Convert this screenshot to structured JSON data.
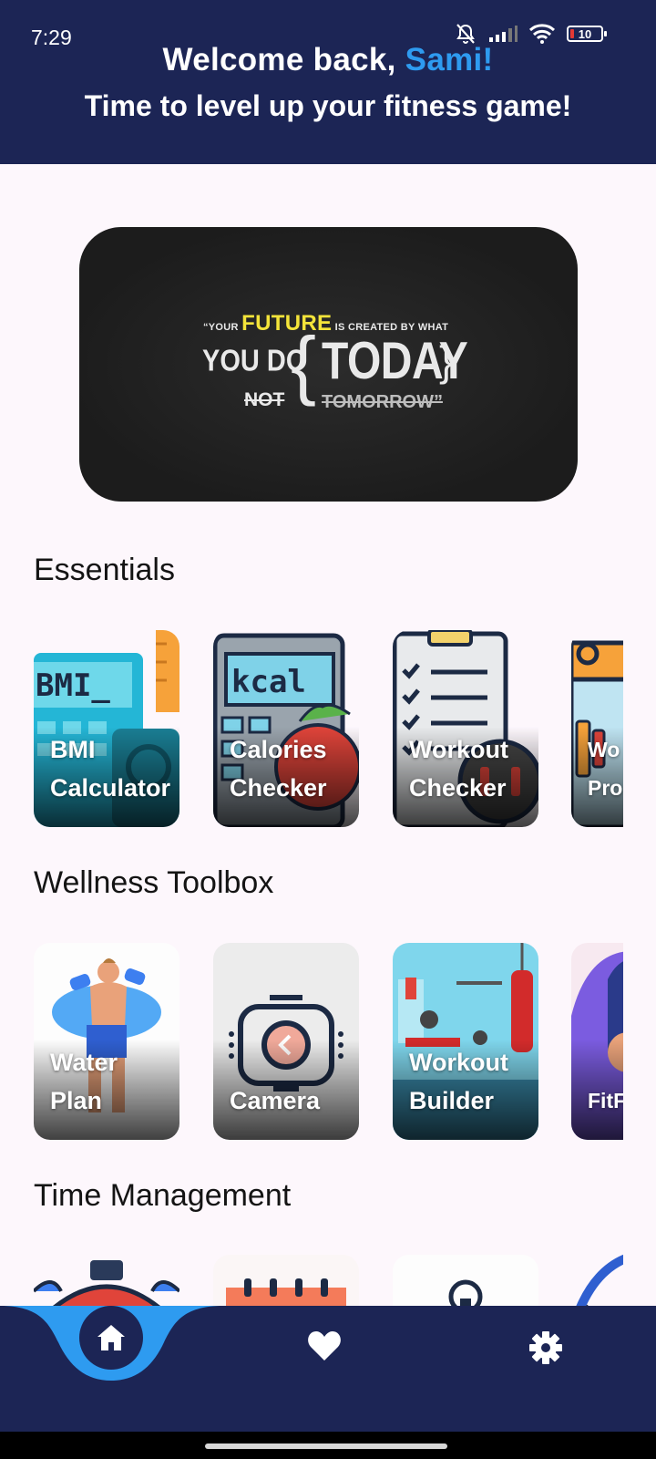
{
  "status_bar": {
    "time": "7:29",
    "battery": "10"
  },
  "header": {
    "welcome_prefix": "Welcome back, ",
    "user_name": "Sami!",
    "subtitle": "Time to level up your fitness game!"
  },
  "banner": {
    "quote_open": "“YOUR",
    "quote_future": "FUTURE",
    "quote_created": "IS CREATED BY WHAT",
    "quote_you_do": "YOU DO",
    "quote_not": "NOT",
    "quote_brace_open": "{",
    "quote_today": "TODAY",
    "quote_brace_close": "}",
    "quote_tomorrow": "TOMORROW”"
  },
  "sections": {
    "essentials": {
      "title": "Essentials",
      "cards": [
        {
          "line1": "BMI",
          "line2": "Calculator"
        },
        {
          "line1": "Calories",
          "line2": "Checker"
        },
        {
          "line1": "Workout",
          "line2": "Checker"
        },
        {
          "line1": "Wo",
          "line2": "Pro"
        }
      ]
    },
    "wellness": {
      "title": "Wellness Toolbox",
      "cards": [
        {
          "line1": "Water",
          "line2": "Plan"
        },
        {
          "line1": "",
          "line2": "Camera"
        },
        {
          "line1": "Workout",
          "line2": "Builder"
        },
        {
          "line1": "",
          "line2": "FitF"
        }
      ]
    },
    "time": {
      "title": "Time Management"
    }
  },
  "colors": {
    "header_bg": "#1c2555",
    "accent": "#2e9bf0",
    "page_bg": "#fdf7fc",
    "banner_yellow": "#f4e43a"
  },
  "nav": {
    "items": [
      "home-icon",
      "heart-icon",
      "gear-icon"
    ],
    "active": "home-icon"
  }
}
